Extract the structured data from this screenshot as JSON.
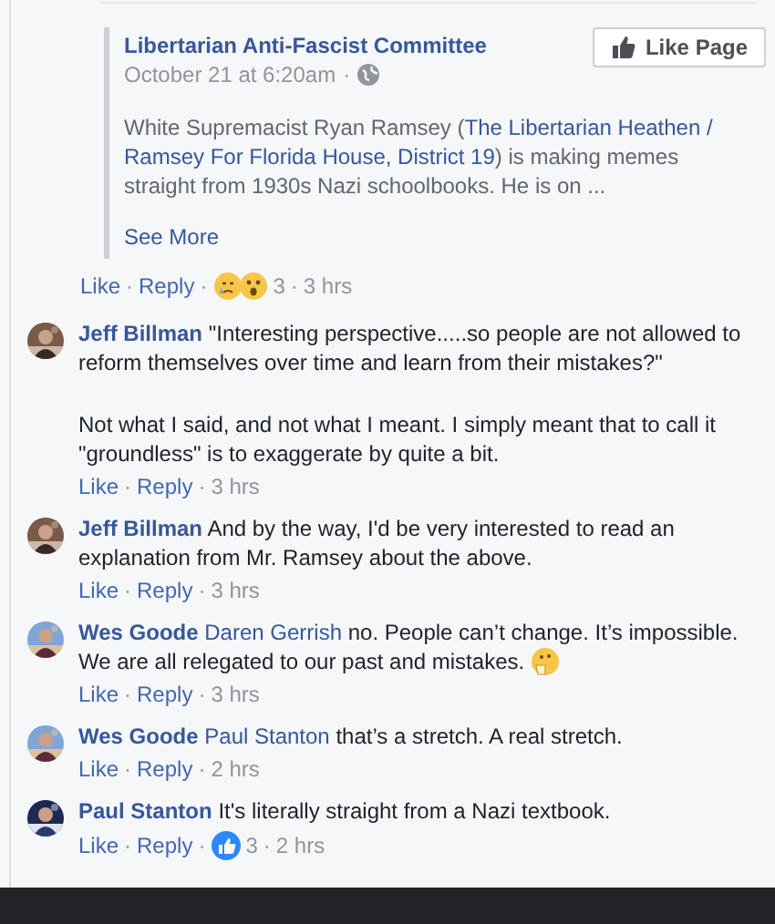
{
  "shared_post": {
    "page_name": "Libertarian Anti-Fascist Committee",
    "timestamp": "October 21 at 6:20am",
    "separator": "·",
    "like_page_button": "Like Page",
    "body": [
      {
        "kind": "text",
        "text": "White Supremacist Ryan Ramsey ("
      },
      {
        "kind": "link",
        "text": "The Libertarian Heathen /"
      },
      {
        "kind": "link",
        "text": "Ramsey For Florida House, District 19"
      },
      {
        "kind": "text",
        "text": ") is making memes straight from 1930s Nazi schoolbooks. He is on ..."
      }
    ],
    "see_more": "See More"
  },
  "post_actions": [
    {
      "kind": "link",
      "text": "Like"
    },
    {
      "kind": "sep",
      "text": "·"
    },
    {
      "kind": "link",
      "text": "Reply"
    },
    {
      "kind": "sep",
      "text": "·"
    },
    {
      "kind": "sad"
    },
    {
      "kind": "wow"
    },
    {
      "kind": "count",
      "text": "3"
    },
    {
      "kind": "sep",
      "text": "·"
    },
    {
      "kind": "time",
      "text": "3 hrs"
    }
  ],
  "comments": [
    {
      "author": "Jeff Billman",
      "paragraphs": [
        "\"Interesting perspective.....so people are not allowed to reform themselves over time and learn from their mistakes?\"",
        "Not what I said, and not what I meant. I simply meant that to call it \"groundless\" is to exaggerate by quite a bit."
      ],
      "actions": [
        {
          "kind": "link",
          "text": "Like"
        },
        {
          "kind": "sep",
          "text": "·"
        },
        {
          "kind": "link",
          "text": "Reply"
        },
        {
          "kind": "sep",
          "text": "·"
        },
        {
          "kind": "time",
          "text": "3 hrs"
        }
      ]
    },
    {
      "author": "Jeff Billman",
      "paragraphs": [
        "And by the way, I'd be very interested to read an explanation from Mr. Ramsey about the above."
      ],
      "actions": [
        {
          "kind": "link",
          "text": "Like"
        },
        {
          "kind": "sep",
          "text": "·"
        },
        {
          "kind": "link",
          "text": "Reply"
        },
        {
          "kind": "sep",
          "text": "·"
        },
        {
          "kind": "time",
          "text": "3 hrs"
        }
      ]
    },
    {
      "author": "Wes Goode",
      "mention": "Daren Gerrish",
      "paragraphs": [
        "no. People can’t change. It’s impossible. We are all relegated to our past and mistakes."
      ],
      "emoji": true,
      "actions": [
        {
          "kind": "link",
          "text": "Like"
        },
        {
          "kind": "sep",
          "text": "·"
        },
        {
          "kind": "link",
          "text": "Reply"
        },
        {
          "kind": "sep",
          "text": "·"
        },
        {
          "kind": "time",
          "text": "3 hrs"
        }
      ]
    },
    {
      "author": "Wes Goode",
      "mention": "Paul Stanton",
      "paragraphs": [
        "that’s a stretch. A real stretch."
      ],
      "actions": [
        {
          "kind": "link",
          "text": "Like"
        },
        {
          "kind": "sep",
          "text": "·"
        },
        {
          "kind": "link",
          "text": "Reply"
        },
        {
          "kind": "sep",
          "text": "·"
        },
        {
          "kind": "time",
          "text": "2 hrs"
        }
      ]
    },
    {
      "author": "Paul Stanton",
      "paragraphs": [
        "It's literally straight from a Nazi textbook."
      ],
      "actions": [
        {
          "kind": "link",
          "text": "Like"
        },
        {
          "kind": "sep",
          "text": "·"
        },
        {
          "kind": "link",
          "text": "Reply"
        },
        {
          "kind": "sep",
          "text": "·"
        },
        {
          "kind": "like_reaction"
        },
        {
          "kind": "count",
          "text": "3"
        },
        {
          "kind": "sep",
          "text": "·"
        },
        {
          "kind": "time",
          "text": "2 hrs"
        }
      ]
    }
  ]
}
